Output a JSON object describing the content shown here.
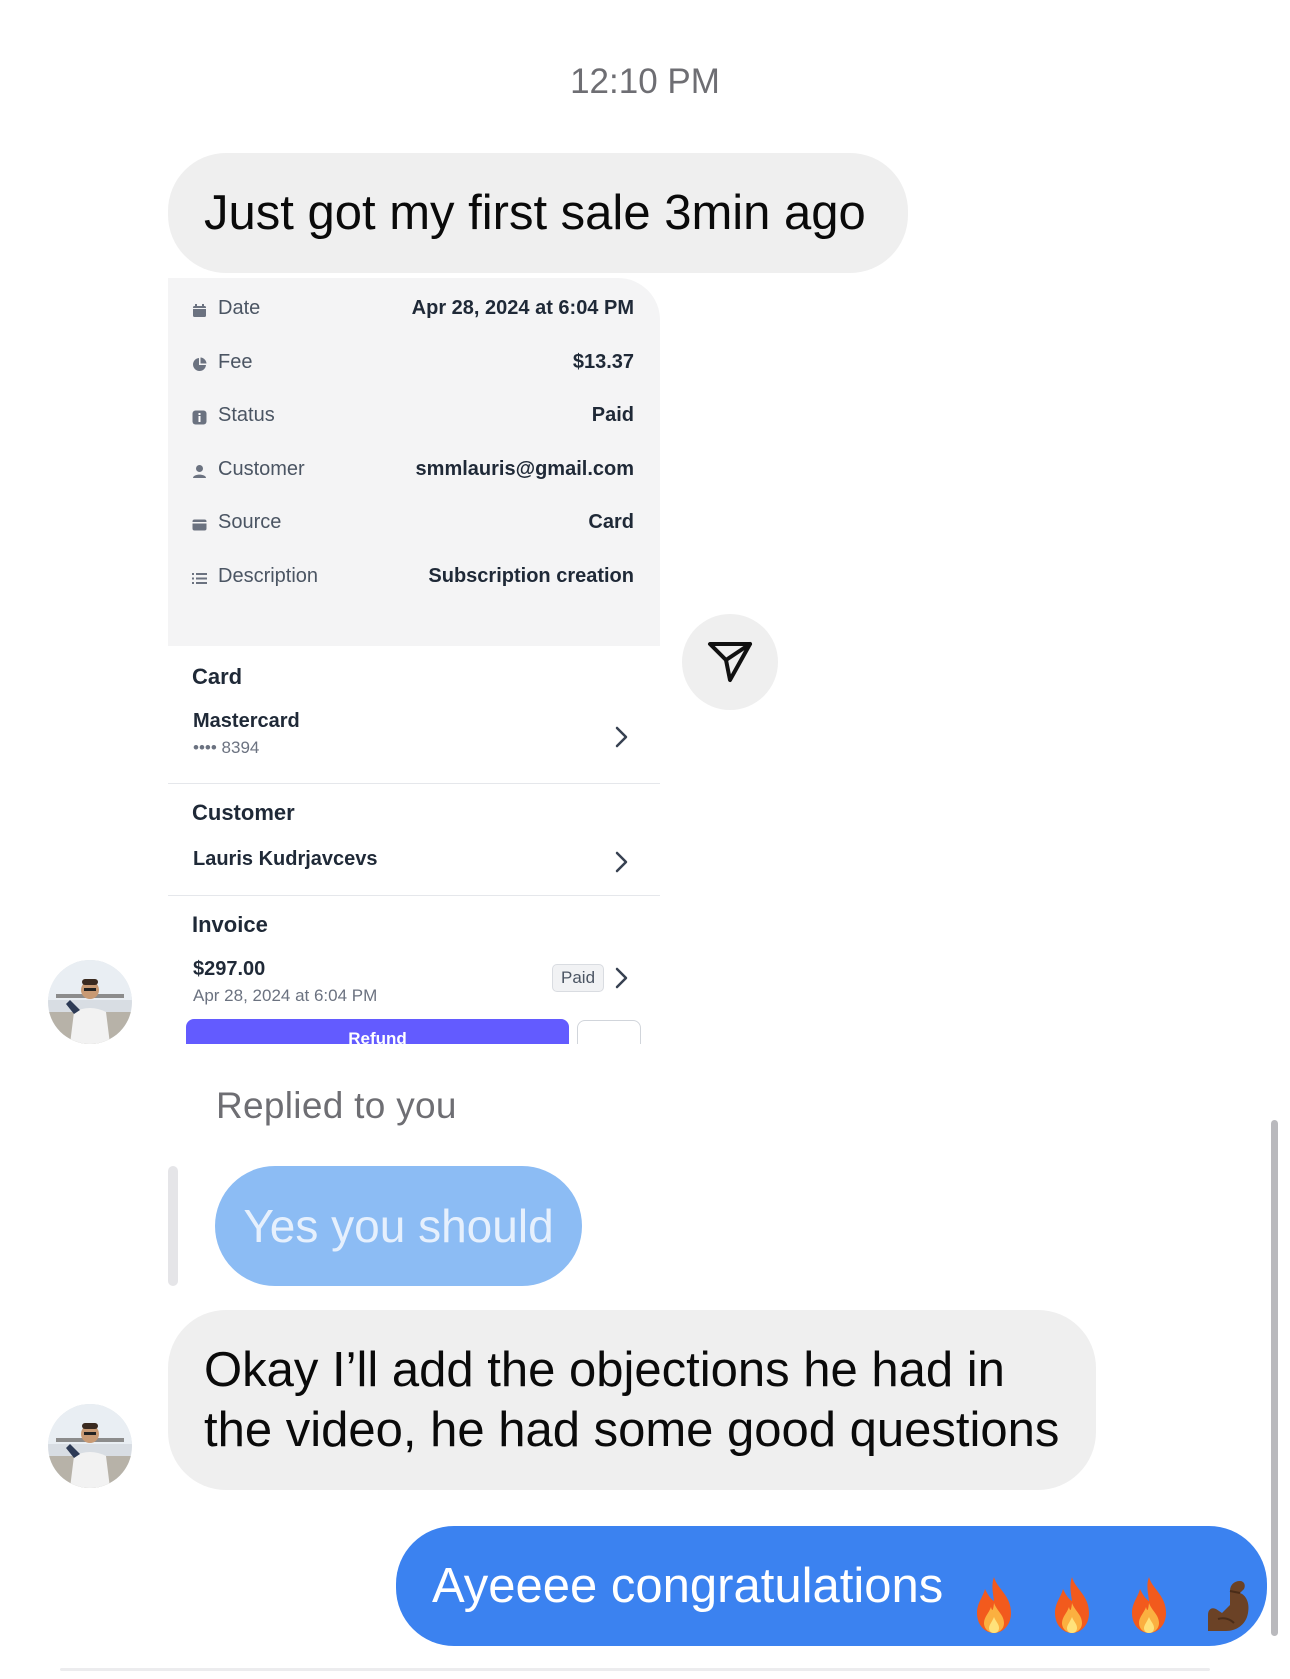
{
  "chat": {
    "timestamp": "12:10 PM",
    "msg_first_sale": "Just got my first sale 3min ago",
    "replied_label": "Replied to you",
    "quoted_reply": "Yes you should",
    "msg_objections": "Okay I’ll add the objections he had in the video, he had some good questions",
    "msg_congrats": "Ayeeee congratulations",
    "congrats_emojis": [
      "fire-icon",
      "fire-icon",
      "fire-icon",
      "flexed-biceps-icon"
    ]
  },
  "payment_card": {
    "details": [
      {
        "icon": "calendar-icon",
        "label": "Date",
        "value": "Apr 28, 2024 at 6:04 PM"
      },
      {
        "icon": "pie-chart-icon",
        "label": "Fee",
        "value": "$13.37"
      },
      {
        "icon": "info-icon",
        "label": "Status",
        "value": "Paid"
      },
      {
        "icon": "person-icon",
        "label": "Customer",
        "value": "smmlauris@gmail.com"
      },
      {
        "icon": "wallet-icon",
        "label": "Source",
        "value": "Card"
      },
      {
        "icon": "list-icon",
        "label": "Description",
        "value": "Subscription creation"
      }
    ],
    "card_section": {
      "title": "Card",
      "brand": "Mastercard",
      "last4": "•••• 8394"
    },
    "customer_section": {
      "title": "Customer",
      "name": "Lauris Kudrjavcevs"
    },
    "invoice_section": {
      "title": "Invoice",
      "amount": "$297.00",
      "date": "Apr 28, 2024 at 6:04 PM",
      "status": "Paid"
    },
    "refund_label": "Refund"
  },
  "colors": {
    "incoming_bubble": "#efefef",
    "outgoing_bubble": "#3b82f0",
    "quoted_bubble": "#8cbcf4",
    "refund_button": "#635bff"
  }
}
